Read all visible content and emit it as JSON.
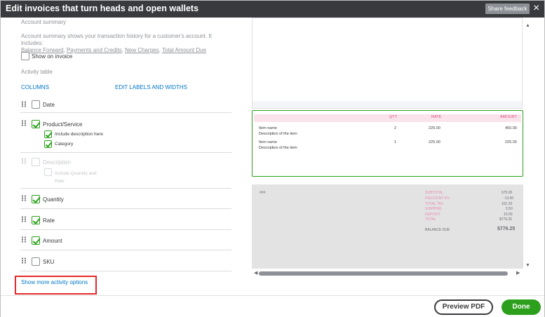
{
  "header": {
    "title": "Edit invoices that turn heads and open wallets",
    "feedback_label": "Share feedback",
    "close_glyph": "×"
  },
  "account_summary": {
    "heading": "Account summary",
    "desc_line1": "Account summary shows your transaction history for a customer's account. It includes:",
    "links": [
      "Balance Forward",
      "Payments and Credits",
      "New Charges",
      "Total Amount Due"
    ],
    "show_on_invoice_label": "Show on invoice",
    "show_on_invoice_checked": false
  },
  "activity_table": {
    "heading": "Activity table",
    "columns_label": "COLUMNS",
    "edit_labels_link": "EDIT LABELS AND WIDTHS",
    "columns": [
      {
        "label": "Date",
        "checked": false,
        "enabled": true
      },
      {
        "label": "Product/Service",
        "checked": true,
        "enabled": true,
        "suboptions": [
          {
            "label": "Include description here",
            "checked": true
          },
          {
            "label": "Category",
            "checked": true
          }
        ]
      },
      {
        "label": "Description",
        "checked": false,
        "enabled": false,
        "suboptions": [
          {
            "label_line1": "Include Quantity and",
            "label_line2": "Rate",
            "checked": false
          }
        ]
      },
      {
        "label": "Quantity",
        "checked": true,
        "enabled": true
      },
      {
        "label": "Rate",
        "checked": true,
        "enabled": true
      },
      {
        "label": "Amount",
        "checked": true,
        "enabled": true
      },
      {
        "label": "SKU",
        "checked": false,
        "enabled": true
      }
    ],
    "show_more_link": "Show more activity options"
  },
  "preview": {
    "table_headers": {
      "qty": "QTY",
      "rate": "RATE",
      "amount": "AMOUNT"
    },
    "rows": [
      {
        "name": "Item name",
        "desc": "Description of the item",
        "qty": "2",
        "rate": "225.00",
        "amount": "450.00"
      },
      {
        "name": "Item name",
        "desc": "Description of the item",
        "qty": "1",
        "rate": "225.00",
        "amount": "225.00"
      }
    ],
    "summary_left": "###",
    "summary": [
      {
        "label": "SUBTOTAL",
        "value": "675.00"
      },
      {
        "label": "DISCOUNT 5%",
        "value": "-13.50"
      },
      {
        "label": "TOTAL TAX",
        "value": "101.25"
      },
      {
        "label": "SHIPPING",
        "value": "5.50"
      },
      {
        "label": "DEPOSIT",
        "value": "10.00"
      },
      {
        "label": "TOTAL",
        "value": "$776.25"
      }
    ],
    "balance_due_label": "BALANCE DUE",
    "balance_due_value": "$776.25"
  },
  "footer": {
    "preview_pdf_label": "Preview PDF",
    "done_label": "Done"
  },
  "colors": {
    "header_bg": "#393a3d",
    "accent_green": "#2ca01c",
    "link_blue": "#0077c5",
    "highlight_red": "#e5282b",
    "table_header_pink": "#fbe3ec"
  }
}
